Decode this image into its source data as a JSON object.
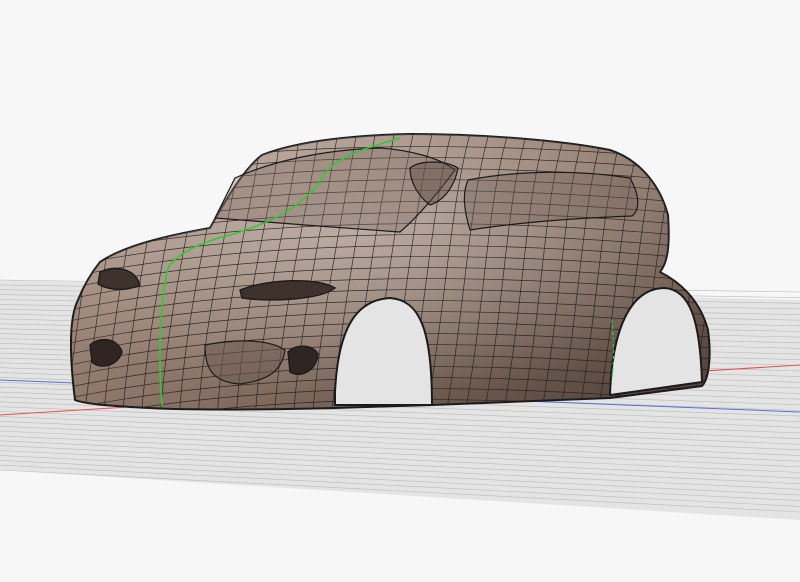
{
  "viewport": {
    "background": "#f7f7f7",
    "ground_color": "#e4e4e4",
    "grid_line_color": "#b9b9b9",
    "x_axis_color": "#e0534c",
    "y_axis_color": "#5b6fe0"
  },
  "model": {
    "body_fill_light": "#b8a193",
    "body_fill_mid": "#8a7366",
    "body_fill_dark": "#4d3e36",
    "isoparm_color": "#1c1b1b",
    "center_curve_color": "#2ecc2e"
  }
}
